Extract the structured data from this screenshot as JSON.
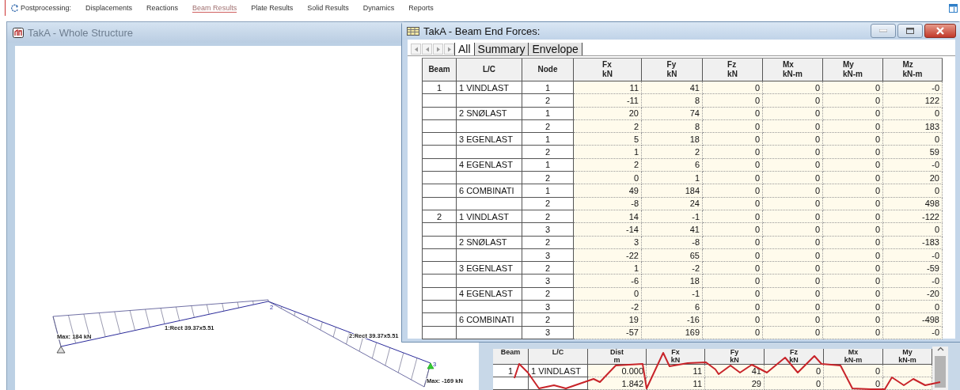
{
  "toolbar": {
    "label": "Postprocessing:",
    "items": [
      {
        "label": "Displacements",
        "selected": false
      },
      {
        "label": "Reactions",
        "selected": false
      },
      {
        "label": "Beam Results",
        "selected": true
      },
      {
        "label": "Plate Results",
        "selected": false
      },
      {
        "label": "Solid Results",
        "selected": false
      },
      {
        "label": "Dynamics",
        "selected": false
      },
      {
        "label": "Reports",
        "selected": false
      }
    ]
  },
  "structure_window": {
    "title": "TakA - Whole Structure",
    "labels": [
      {
        "kind": "max",
        "text": "Max: 184 kN"
      },
      {
        "kind": "member",
        "text": "1:Rect 39.37x5.51"
      },
      {
        "kind": "member",
        "text": "2:Rect 39.37x5.51"
      },
      {
        "kind": "max",
        "text": "Max: -169 kN"
      },
      {
        "kind": "node",
        "text": "2"
      },
      {
        "kind": "node",
        "text": "3"
      }
    ]
  },
  "forces_window": {
    "title": "TakA - Beam End Forces:",
    "tabs": [
      {
        "label": "All",
        "selected": true
      },
      {
        "label": "Summary",
        "selected": false
      },
      {
        "label": "Envelope",
        "selected": false
      }
    ],
    "columns": [
      {
        "name": "Beam"
      },
      {
        "name": "L/C"
      },
      {
        "name": "Node"
      },
      {
        "name": "Fx",
        "unit": "kN"
      },
      {
        "name": "Fy",
        "unit": "kN"
      },
      {
        "name": "Fz",
        "unit": "kN"
      },
      {
        "name": "Mx",
        "unit": "kN-m"
      },
      {
        "name": "My",
        "unit": "kN-m"
      },
      {
        "name": "Mz",
        "unit": "kN-m"
      }
    ],
    "rows": [
      [
        "1",
        "1 VINDLAST",
        "1",
        "11",
        "41",
        "0",
        "0",
        "0",
        "-0"
      ],
      [
        "",
        "",
        "2",
        "-11",
        "8",
        "0",
        "0",
        "0",
        "122"
      ],
      [
        "",
        "2 SNØLAST",
        "1",
        "20",
        "74",
        "0",
        "0",
        "0",
        "0"
      ],
      [
        "",
        "",
        "2",
        "2",
        "8",
        "0",
        "0",
        "0",
        "183"
      ],
      [
        "",
        "3 EGENLAST",
        "1",
        "5",
        "18",
        "0",
        "0",
        "0",
        "0"
      ],
      [
        "",
        "",
        "2",
        "1",
        "2",
        "0",
        "0",
        "0",
        "59"
      ],
      [
        "",
        "4  EGENLAST",
        "1",
        "2",
        "6",
        "0",
        "0",
        "0",
        "-0"
      ],
      [
        "",
        "",
        "2",
        "0",
        "1",
        "0",
        "0",
        "0",
        "20"
      ],
      [
        "",
        "6 COMBINATI",
        "1",
        "49",
        "184",
        "0",
        "0",
        "0",
        "0"
      ],
      [
        "",
        "",
        "2",
        "-8",
        "24",
        "0",
        "0",
        "0",
        "498"
      ],
      [
        "2",
        "1 VINDLAST",
        "2",
        "14",
        "-1",
        "0",
        "0",
        "0",
        "-122"
      ],
      [
        "",
        "",
        "3",
        "-14",
        "41",
        "0",
        "0",
        "0",
        "0"
      ],
      [
        "",
        "2 SNØLAST",
        "2",
        "3",
        "-8",
        "0",
        "0",
        "0",
        "-183"
      ],
      [
        "",
        "",
        "3",
        "-22",
        "65",
        "0",
        "0",
        "0",
        "-0"
      ],
      [
        "",
        "3 EGENLAST",
        "2",
        "1",
        "-2",
        "0",
        "0",
        "0",
        "-59"
      ],
      [
        "",
        "",
        "3",
        "-6",
        "18",
        "0",
        "0",
        "0",
        "-0"
      ],
      [
        "",
        "4  EGENLAST",
        "2",
        "0",
        "-1",
        "0",
        "0",
        "0",
        "-20"
      ],
      [
        "",
        "",
        "3",
        "-2",
        "6",
        "0",
        "0",
        "0",
        "0"
      ],
      [
        "",
        "6 COMBINATI",
        "2",
        "19",
        "-16",
        "0",
        "0",
        "0",
        "-498"
      ],
      [
        "",
        "",
        "3",
        "-57",
        "169",
        "0",
        "0",
        "0",
        "-0"
      ]
    ]
  },
  "intermediate_table": {
    "columns": [
      {
        "name": "Beam"
      },
      {
        "name": "L/C"
      },
      {
        "name": "Dist",
        "unit": "m"
      },
      {
        "name": "Fx",
        "unit": "kN"
      },
      {
        "name": "Fy",
        "unit": "kN"
      },
      {
        "name": "Fz",
        "unit": "kN"
      },
      {
        "name": "Mx",
        "unit": "kN-m"
      },
      {
        "name": "My",
        "unit": "kN-m"
      }
    ],
    "rows": [
      [
        "1",
        "1 VINDLAST",
        "0.000",
        "11",
        "41",
        "0",
        "0",
        ""
      ],
      [
        "",
        "",
        "1.842",
        "11",
        "29",
        "0",
        "0",
        ""
      ]
    ]
  }
}
